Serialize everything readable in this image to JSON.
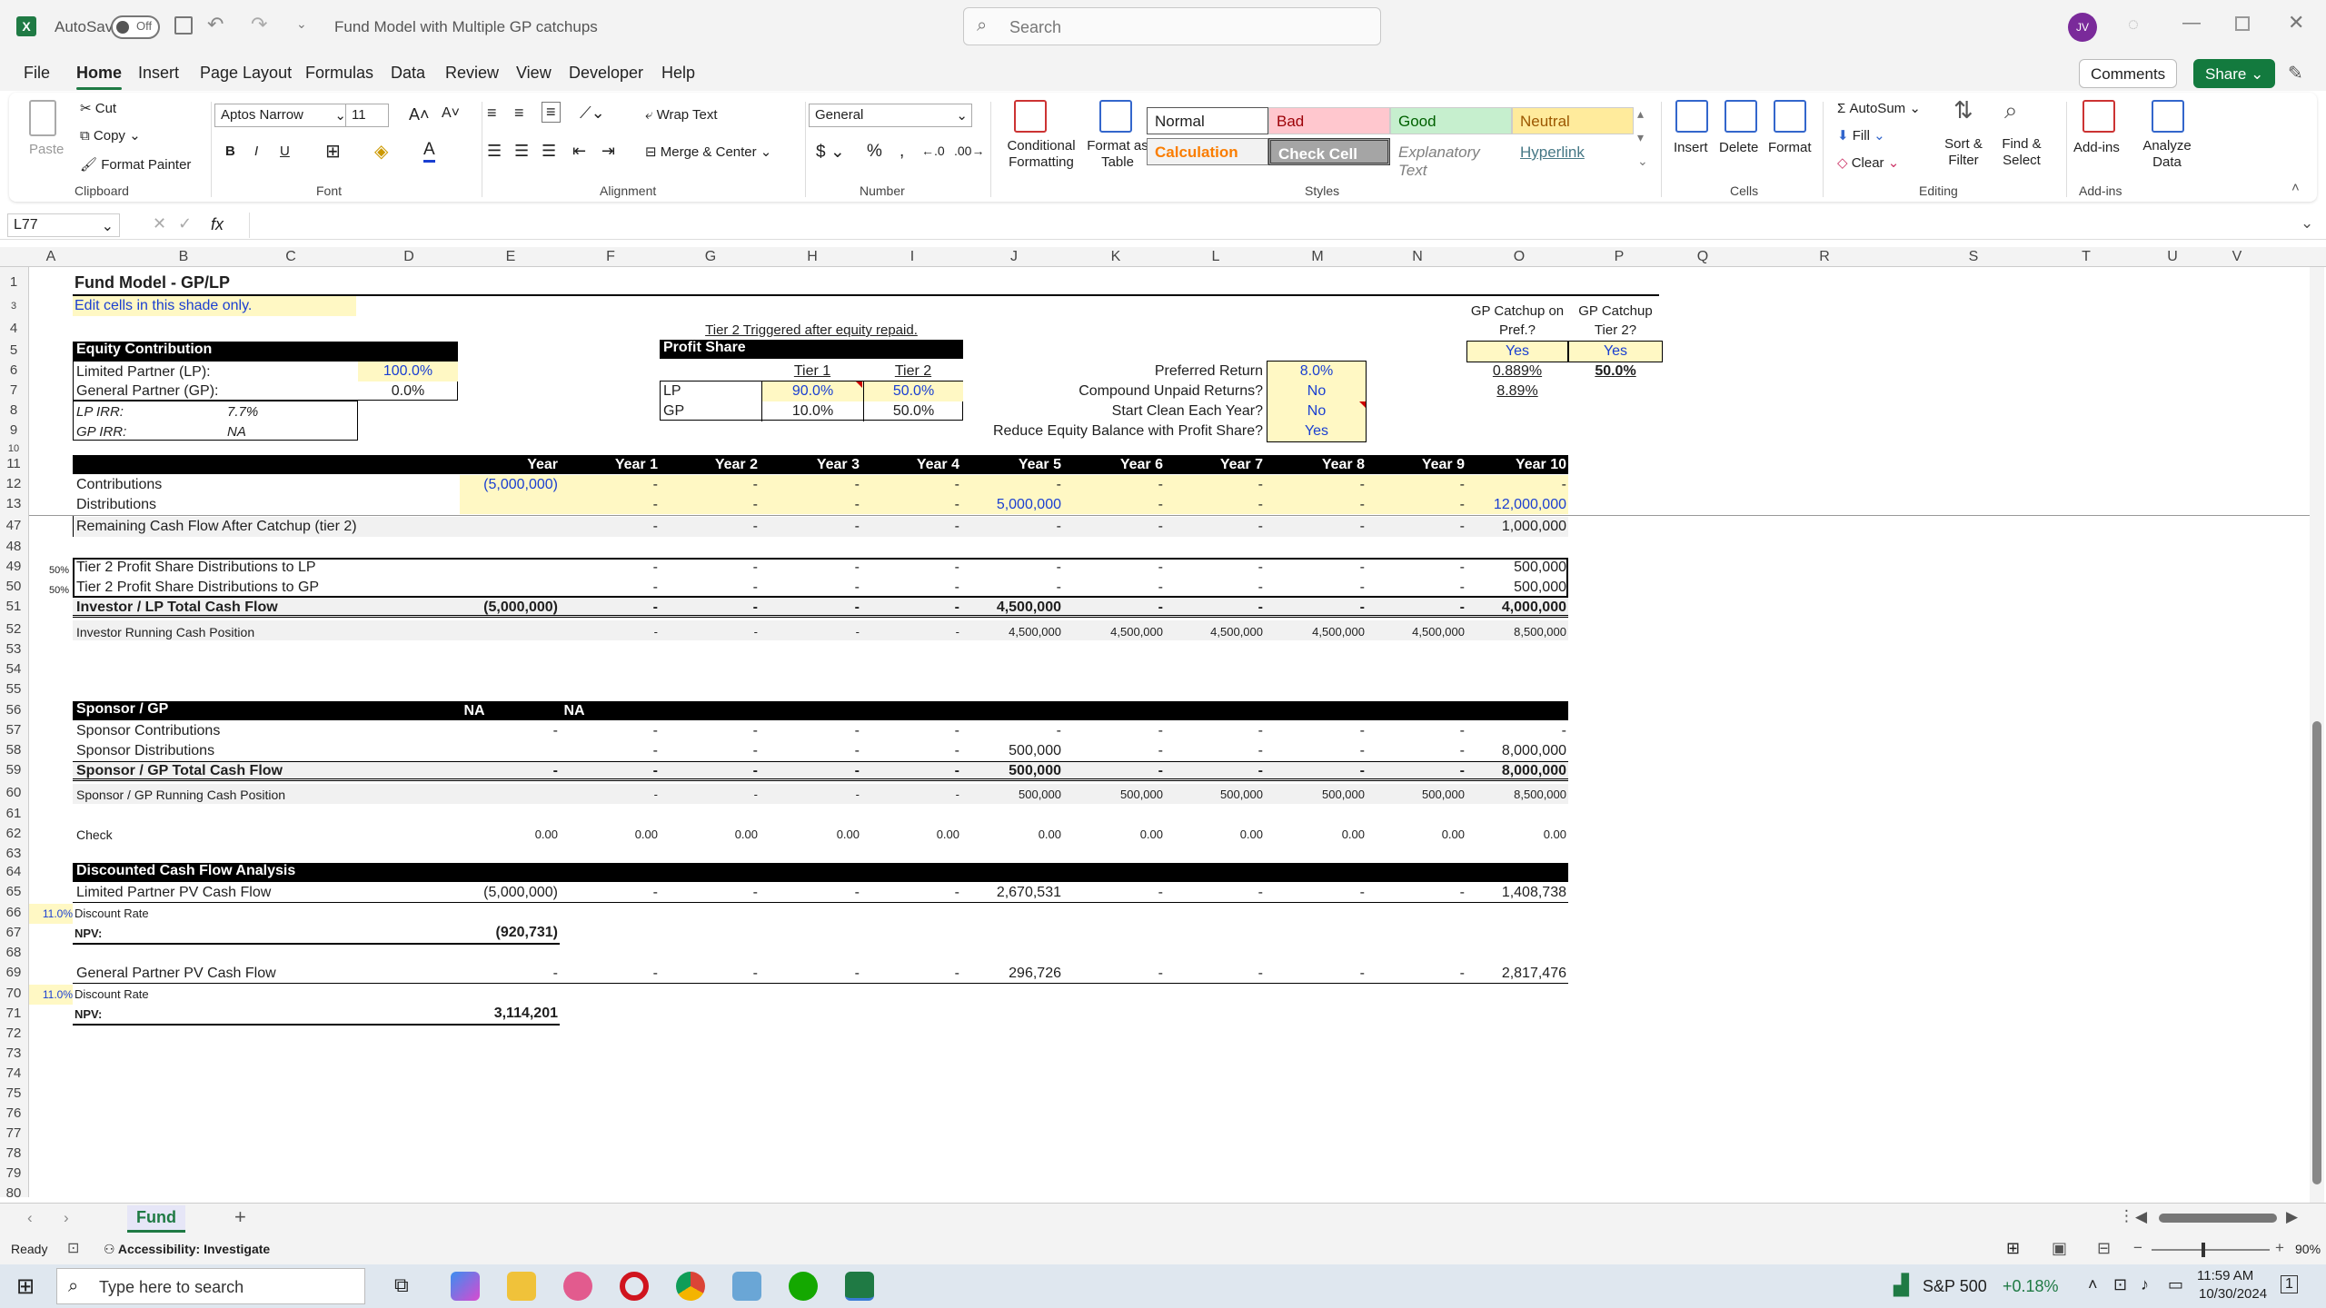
{
  "app": {
    "autosave": "AutoSave",
    "autosave_state": "Off",
    "doc_title": "Fund Model with Multiple GP catchups",
    "search_placeholder": "Search",
    "avatar": "JV"
  },
  "menu": [
    "File",
    "Home",
    "Insert",
    "Page Layout",
    "Formulas",
    "Data",
    "Review",
    "View",
    "Developer",
    "Help"
  ],
  "menu_buttons": {
    "comments": "Comments",
    "share": "Share"
  },
  "ribbon": {
    "clipboard": {
      "paste": "Paste",
      "cut": "Cut",
      "copy": "Copy",
      "format_painter": "Format Painter",
      "group": "Clipboard"
    },
    "font": {
      "name": "Aptos Narrow",
      "size": "11",
      "group": "Font"
    },
    "alignment": {
      "wrap": "Wrap Text",
      "merge": "Merge & Center",
      "group": "Alignment"
    },
    "number": {
      "format": "General",
      "group": "Number"
    },
    "styles": {
      "cond": "Conditional Formatting",
      "table": "Format as Table",
      "normal": "Normal",
      "bad": "Bad",
      "good": "Good",
      "neutral": "Neutral",
      "calc": "Calculation",
      "check": "Check Cell",
      "explan": "Explanatory Text",
      "hyper": "Hyperlink",
      "group": "Styles"
    },
    "cells": {
      "insert": "Insert",
      "delete": "Delete",
      "format": "Format",
      "group": "Cells"
    },
    "editing": {
      "autosum": "AutoSum",
      "fill": "Fill",
      "clear": "Clear",
      "sort": "Sort & Filter",
      "find": "Find & Select",
      "group": "Editing"
    },
    "addins": {
      "addins": "Add-ins",
      "analyze": "Analyze Data",
      "group": "Add-ins"
    }
  },
  "formula_bar": {
    "name_box": "L77",
    "fx": "fx"
  },
  "columns": [
    "A",
    "B",
    "C",
    "D",
    "E",
    "F",
    "G",
    "H",
    "I",
    "J",
    "K",
    "L",
    "M",
    "N",
    "O",
    "P",
    "Q",
    "R",
    "S",
    "T",
    "U",
    "V"
  ],
  "rows": [
    "1",
    "3",
    "4",
    "5",
    "6",
    "7",
    "8",
    "9",
    "10",
    "11",
    "12",
    "13",
    "47",
    "48",
    "49",
    "50",
    "51",
    "52",
    "53",
    "54",
    "55",
    "56",
    "57",
    "58",
    "59",
    "60",
    "61",
    "62",
    "63",
    "64",
    "65",
    "66",
    "67",
    "68",
    "69",
    "70",
    "71",
    "72",
    "73",
    "74",
    "75",
    "76",
    "77",
    "78",
    "79",
    "80"
  ],
  "sheet": {
    "title": "Fund Model - GP/LP",
    "edit_note": "Edit cells in this shade only.",
    "equity": {
      "header": "Equity Contribution",
      "lp_label": "Limited Partner (LP):",
      "lp_val": "100.0%",
      "gp_label": "General Partner (GP):",
      "gp_val": "0.0%",
      "lp_irr_label": "LP IRR:",
      "lp_irr": "7.7%",
      "gp_irr_label": "GP IRR:",
      "gp_irr": "NA"
    },
    "tier_note": "Tier 2 Triggered after equity repaid.",
    "profit": {
      "header": "Profit Share",
      "tier1": "Tier 1",
      "tier2": "Tier 2",
      "lp": "LP",
      "lp_t1": "90.0%",
      "lp_t2": "50.0%",
      "gp": "GP",
      "gp_t1": "10.0%",
      "gp_t2": "50.0%"
    },
    "params": {
      "pref_label": "Preferred Return",
      "pref": "8.0%",
      "comp_label": "Compound Unpaid Returns?",
      "comp": "No",
      "clean_label": "Start Clean Each Year?",
      "clean": "No",
      "reduce_label": "Reduce Equity Balance with Profit Share?",
      "reduce": "Yes"
    },
    "catchup": {
      "pref_head1": "GP Catchup on",
      "pref_head2": "Pref.?",
      "tier_head1": "GP Catchup",
      "tier_head2": "Tier 2?",
      "pref_val": "Yes",
      "tier_val": "Yes",
      "v1": "0.889%",
      "v2": "8.89%",
      "v3": "50.0%"
    },
    "years": [
      "Year",
      "Year 1",
      "Year 2",
      "Year 3",
      "Year 4",
      "Year 5",
      "Year 6",
      "Year 7",
      "Year 8",
      "Year 9",
      "Year 10"
    ],
    "rows": {
      "contrib": {
        "label": "Contributions",
        "vals": [
          "(5,000,000)",
          "-",
          "-",
          "-",
          "-",
          "-",
          "-",
          "-",
          "-",
          "-",
          "-"
        ]
      },
      "dist": {
        "label": "Distributions",
        "vals": [
          "",
          "-",
          "-",
          "-",
          "-",
          "5,000,000",
          "-",
          "-",
          "-",
          "-",
          "12,000,000"
        ]
      },
      "remaining": {
        "label": "Remaining Cash Flow After Catchup (tier 2)",
        "vals": [
          "",
          "-",
          "-",
          "-",
          "-",
          "-",
          "-",
          "-",
          "-",
          "-",
          "1,000,000"
        ]
      },
      "t2lp": {
        "pct": "50%",
        "label": "Tier 2 Profit Share Distributions to LP",
        "vals": [
          "",
          "-",
          "-",
          "-",
          "-",
          "-",
          "-",
          "-",
          "-",
          "-",
          "500,000"
        ]
      },
      "t2gp": {
        "pct": "50%",
        "label": "Tier 2 Profit Share Distributions to GP",
        "vals": [
          "",
          "-",
          "-",
          "-",
          "-",
          "-",
          "-",
          "-",
          "-",
          "-",
          "500,000"
        ]
      },
      "lptotal": {
        "label": "Investor / LP Total Cash Flow",
        "vals": [
          "(5,000,000)",
          "-",
          "-",
          "-",
          "-",
          "4,500,000",
          "-",
          "-",
          "-",
          "-",
          "4,000,000"
        ]
      },
      "running": {
        "label": "Investor Running Cash Position",
        "vals": [
          "",
          "-",
          "-",
          "-",
          "-",
          "4,500,000",
          "4,500,000",
          "4,500,000",
          "4,500,000",
          "4,500,000",
          "8,500,000"
        ]
      },
      "sponsor_hdr": {
        "label": "Sponsor / GP",
        "na1": "NA",
        "na2": "NA"
      },
      "spcontrib": {
        "label": "Sponsor Contributions",
        "vals": [
          "-",
          "-",
          "-",
          "-",
          "-",
          "-",
          "-",
          "-",
          "-",
          "-",
          "-"
        ]
      },
      "spdist": {
        "label": "Sponsor Distributions",
        "vals": [
          "",
          "-",
          "-",
          "-",
          "-",
          "500,000",
          "-",
          "-",
          "-",
          "-",
          "8,000,000"
        ]
      },
      "sptotal": {
        "label": "Sponsor / GP Total Cash Flow",
        "vals": [
          "-",
          "-",
          "-",
          "-",
          "-",
          "500,000",
          "-",
          "-",
          "-",
          "-",
          "8,000,000"
        ]
      },
      "sprunning": {
        "label": "Sponsor / GP Running Cash Position",
        "vals": [
          "",
          "-",
          "-",
          "-",
          "-",
          "500,000",
          "500,000",
          "500,000",
          "500,000",
          "500,000",
          "8,500,000"
        ]
      },
      "check": {
        "label": "Check",
        "vals": [
          "0.00",
          "0.00",
          "0.00",
          "0.00",
          "0.00",
          "0.00",
          "0.00",
          "0.00",
          "0.00",
          "0.00",
          "0.00"
        ]
      },
      "dcf_hdr": {
        "label": "Discounted Cash Flow Analysis"
      },
      "lppv": {
        "label": "Limited Partner PV Cash Flow",
        "vals": [
          "(5,000,000)",
          "-",
          "-",
          "-",
          "-",
          "2,670,531",
          "-",
          "-",
          "-",
          "-",
          "1,408,738"
        ]
      },
      "lprate": {
        "pct": "11.0%",
        "label": "Discount Rate"
      },
      "lpnpv": {
        "label": "NPV:",
        "val": "(920,731)"
      },
      "gppv": {
        "label": "General Partner PV Cash Flow",
        "vals": [
          "-",
          "-",
          "-",
          "-",
          "-",
          "296,726",
          "-",
          "-",
          "-",
          "-",
          "2,817,476"
        ]
      },
      "gprate": {
        "pct": "11.0%",
        "label": "Discount Rate"
      },
      "gpnpv": {
        "label": "NPV:",
        "val": "3,114,201"
      }
    }
  },
  "tabs": {
    "sheet": "Fund",
    "add": "+"
  },
  "status": {
    "ready": "Ready",
    "access": "Accessibility: Investigate",
    "zoom": "90%"
  },
  "taskbar": {
    "search": "Type here to search",
    "stock": "S&P 500",
    "stock_chg": "+0.18%",
    "time": "11:59 AM",
    "date": "10/30/2024",
    "notif": "1"
  },
  "colors": {
    "excel_green": "#1f7a44",
    "input_yellow": "#fff8c4",
    "blue_input": "#1a3fd1"
  }
}
